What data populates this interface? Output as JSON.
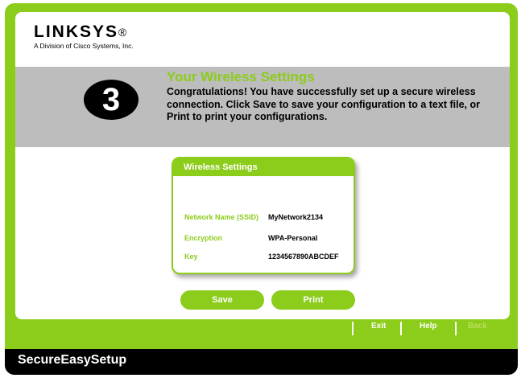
{
  "logo": {
    "brand": "LINKSYS",
    "reg": "®",
    "subtitle": "A Division of Cisco Systems, Inc."
  },
  "step": {
    "number": "3"
  },
  "header": {
    "title": "Your Wireless Settings",
    "message": "Congratulations! You have successfully set up a secure wireless connection. Click Save to save your configuration to a text file, or Print to print your configurations."
  },
  "card": {
    "title": "Wireless Settings",
    "rows": [
      {
        "label": "Network Name (SSID)",
        "value": "MyNetwork2134"
      },
      {
        "label": "Encryption",
        "value": "WPA-Personal"
      },
      {
        "label": "Key",
        "value": "1234567890ABCDEF"
      }
    ]
  },
  "buttons": {
    "save": "Save",
    "print": "Print"
  },
  "nav": {
    "exit": "Exit",
    "help": "Help",
    "back": "Back"
  },
  "footer": {
    "title": "SecureEasySetup"
  },
  "colors": {
    "accent": "#8ccc1b",
    "band": "#bdbdbd",
    "footer": "#000000"
  }
}
